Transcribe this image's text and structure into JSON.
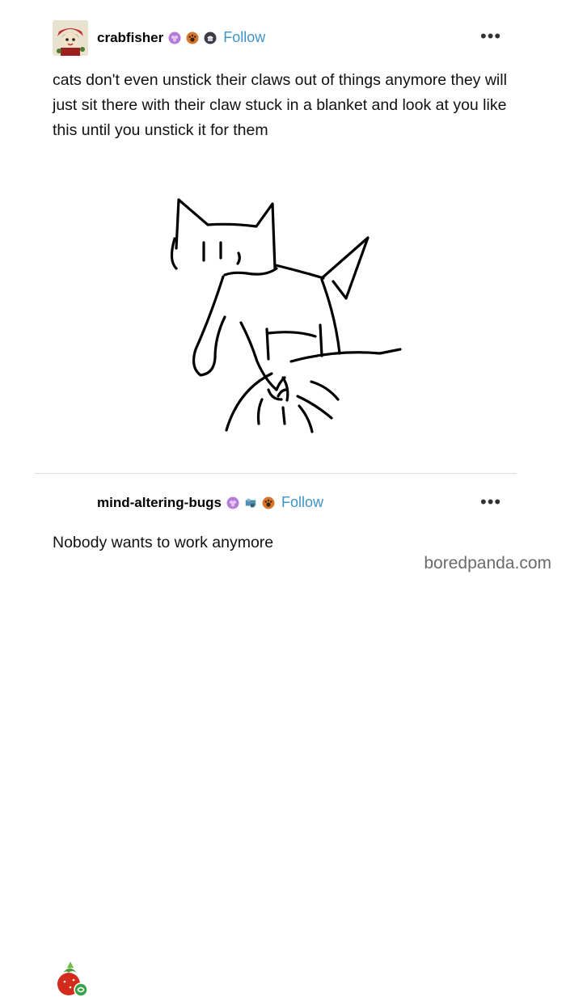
{
  "posts": [
    {
      "username": "crabfisher",
      "follow_label": "Follow",
      "text": "cats don't even unstick their claws out of things anymore they will just sit there with their claw stuck in a blanket and look at you like this until you unstick it for them",
      "badges": [
        "grape-badge",
        "pawprint-badge",
        "cupcake-badge"
      ],
      "drawing": "cat-claw-stuck-sketch"
    },
    {
      "username": "mind-altering-bugs",
      "follow_label": "Follow",
      "text": "Nobody wants to work anymore",
      "badges": [
        "grape-badge",
        "bunny-badge",
        "pawprint-badge"
      ]
    }
  ],
  "watermark": "boredpanda.com",
  "colors": {
    "follow": "#3d93c9",
    "badge_purple": "#b47bd9",
    "badge_orange": "#d8752c"
  }
}
